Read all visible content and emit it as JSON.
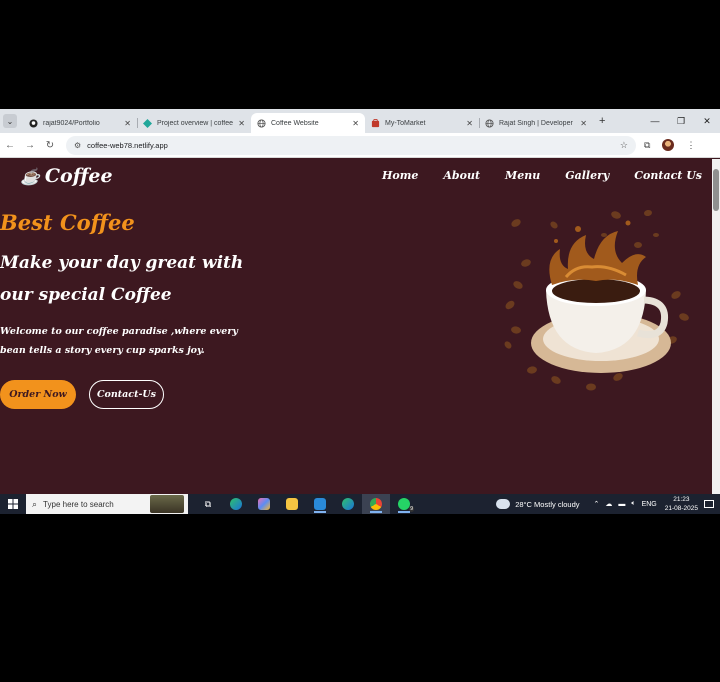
{
  "browser": {
    "tabs": [
      {
        "title": "rajat9024/Portfolio",
        "icon": "github-icon",
        "active": false
      },
      {
        "title": "Project overview | coffee",
        "icon": "netlify-icon",
        "active": false
      },
      {
        "title": "Coffee Website",
        "icon": "globe-icon",
        "active": true
      },
      {
        "title": "My-ToMarket",
        "icon": "cart-icon",
        "active": false
      },
      {
        "title": "Rajat Singh | Developer",
        "icon": "globe-icon",
        "active": false
      }
    ],
    "url": "coffee-web78.netlify.app"
  },
  "site": {
    "logo": "Coffee",
    "nav": [
      "Home",
      "About",
      "Menu",
      "Gallery",
      "Contact Us"
    ],
    "hero": {
      "eyebrow": "Best Coffee",
      "title": "Make your day great with our special Coffee",
      "description": "Welcome to our coffee paradise ,where every bean tells a story every cup sparks joy.",
      "order_button": "Order Now",
      "contact_button": "Contact-Us"
    },
    "colors": {
      "background": "#3d1820",
      "accent": "#f2921c",
      "text": "#ffffff"
    }
  },
  "taskbar": {
    "search_placeholder": "Type here to search",
    "weather": "28°C  Mostly cloudy",
    "language": "ENG",
    "time": "21:23",
    "date": "21-08-2025",
    "whatsapp_badge": "9"
  }
}
